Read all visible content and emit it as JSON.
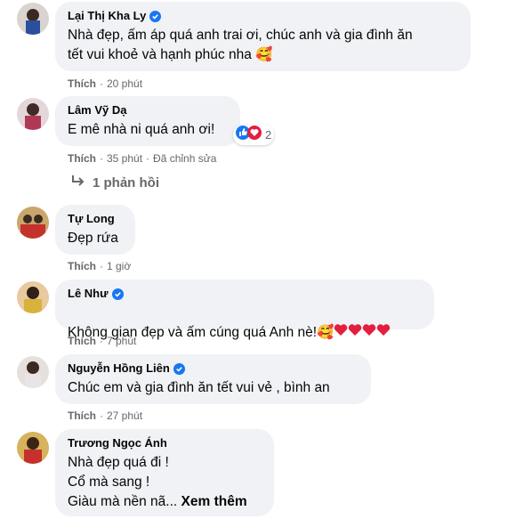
{
  "comments": [
    {
      "name": "Lại Thị Kha Ly",
      "verified": true,
      "lines": [
        "Nhà đẹp, ấm áp quá anh trai ơi, chúc anh và gia đình ăn",
        "tết vui khoẻ và hạnh phúc nha 🥰"
      ],
      "like": "Thích",
      "time": "20 phút"
    },
    {
      "name": "Lâm Vỹ Dạ",
      "verified": false,
      "lines": [
        "E mê nhà ni quá anh ơi!"
      ],
      "like": "Thích",
      "time": "35 phút",
      "edited": "Đã chỉnh sửa",
      "reaction_count": "2",
      "replies": "1 phản hồi"
    },
    {
      "name": "Tự Long",
      "verified": false,
      "lines": [
        "Đẹp rứa"
      ],
      "like": "Thích",
      "time": "1 giờ"
    },
    {
      "name": "Lê Như",
      "verified": true,
      "lines": [
        "Không gian đẹp và ấm cúng quá Anh nè!🥰"
      ],
      "like": "Thích",
      "time": "7 phút"
    },
    {
      "name": "Nguyễn Hồng Liên",
      "verified": true,
      "lines": [
        "Chúc em và gia đình ăn tết vui vẻ , bình an"
      ],
      "like": "Thích",
      "time": "27 phút"
    },
    {
      "name": "Trương Ngọc Ánh",
      "verified": false,
      "lines": [
        "Nhà đẹp quá đi !",
        "Cổ mà sang !",
        "Giàu mà nền nã..."
      ],
      "see_more": "Xem thêm"
    }
  ],
  "colors": {
    "bubble": "#f0f2f5",
    "verified": "#1877f2",
    "meta": "#65676b",
    "heart": "#e41e3f"
  }
}
